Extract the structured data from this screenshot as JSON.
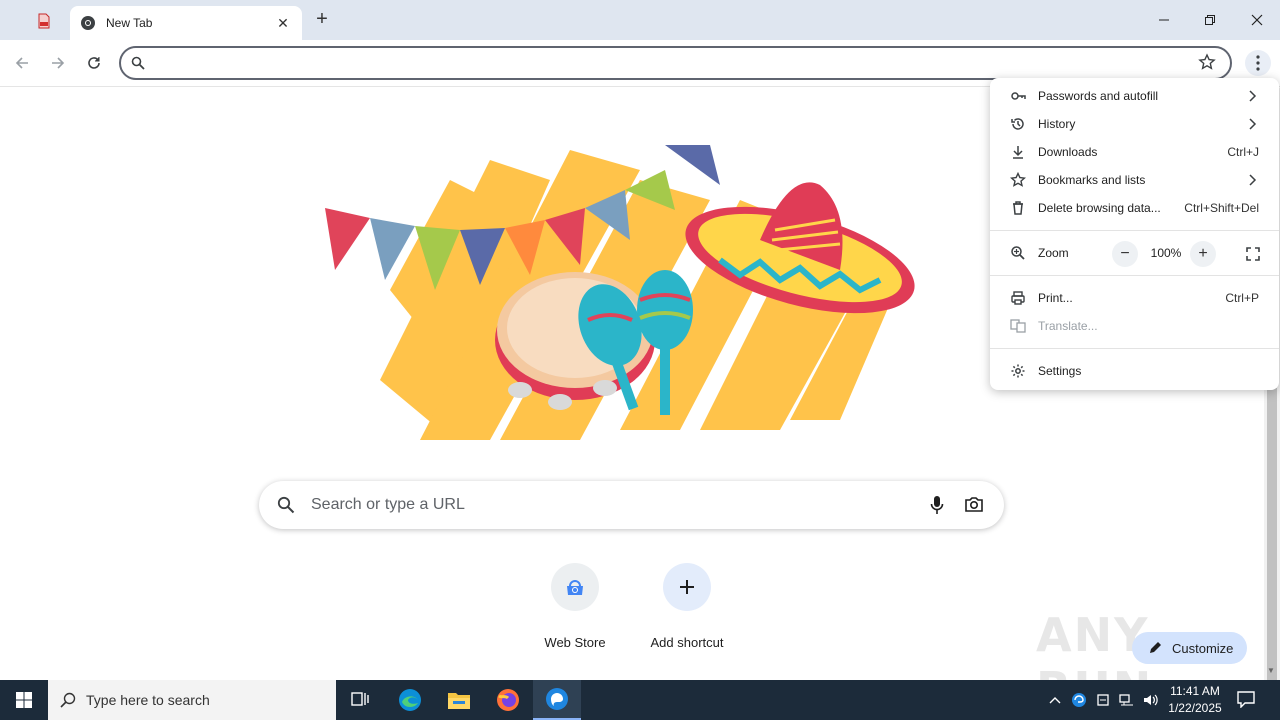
{
  "browser": {
    "tab_title": "New Tab",
    "address_value": "",
    "address_placeholder": ""
  },
  "page": {
    "search_placeholder": "Search or type a URL",
    "shortcuts": [
      {
        "label": "Web Store"
      },
      {
        "label": "Add shortcut"
      }
    ],
    "customize_label": "Customize",
    "watermark": "ANY RUN"
  },
  "menu": {
    "items": [
      {
        "label": "Passwords and autofill",
        "shortcut": "",
        "icon": "key-icon"
      },
      {
        "label": "History",
        "shortcut": "",
        "icon": "history-icon"
      },
      {
        "label": "Downloads",
        "shortcut": "Ctrl+J",
        "icon": "download-icon"
      },
      {
        "label": "Bookmarks and lists",
        "shortcut": "",
        "icon": "star-icon"
      },
      {
        "label": "Delete browsing data...",
        "shortcut": "Ctrl+Shift+Del",
        "icon": "trash-icon"
      }
    ],
    "zoom": {
      "label": "Zoom",
      "value": "100%"
    },
    "print": {
      "label": "Print...",
      "shortcut": "Ctrl+P"
    },
    "translate": {
      "label": "Translate..."
    },
    "settings": {
      "label": "Settings"
    }
  },
  "taskbar": {
    "search_placeholder": "Type here to search",
    "time": "11:41 AM",
    "date": "1/22/2025"
  }
}
